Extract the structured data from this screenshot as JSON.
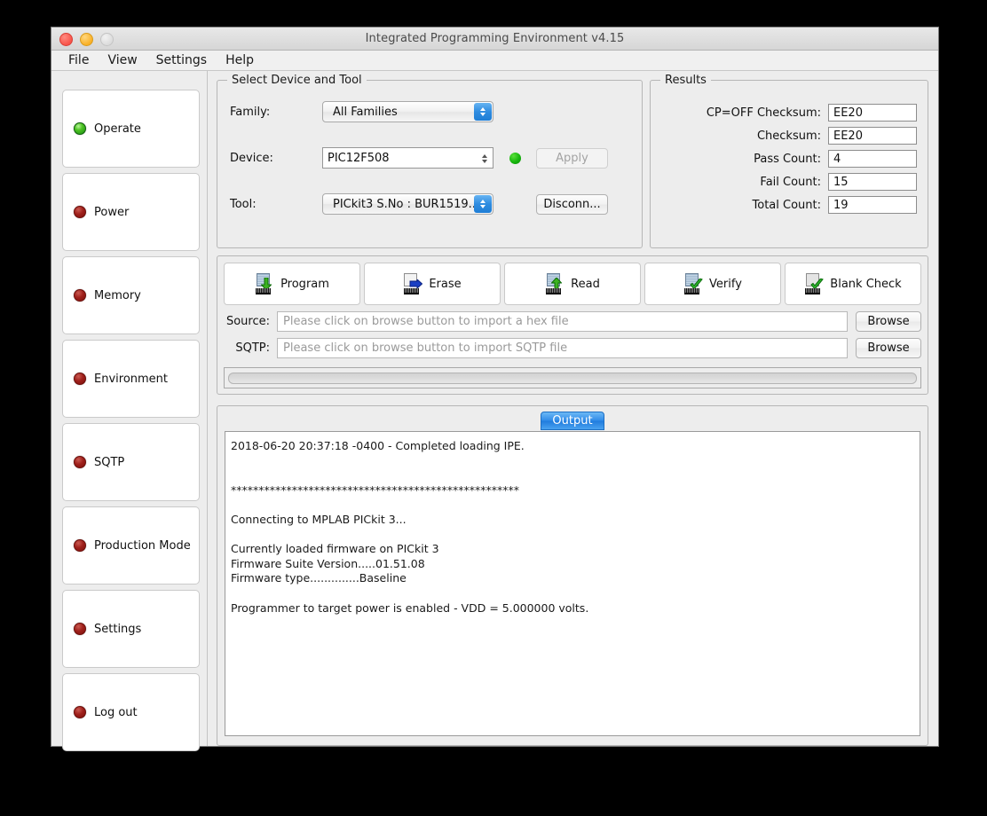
{
  "window": {
    "title": "Integrated Programming Environment v4.15",
    "traffic_lights": [
      "close-button",
      "minimize-button",
      "zoom-button"
    ]
  },
  "menubar": {
    "items": [
      "File",
      "View",
      "Settings",
      "Help"
    ]
  },
  "sidebar": {
    "items": [
      {
        "label": "Operate",
        "led": "green"
      },
      {
        "label": "Power",
        "led": "red"
      },
      {
        "label": "Memory",
        "led": "red"
      },
      {
        "label": "Environment",
        "led": "red"
      },
      {
        "label": "SQTP",
        "led": "red"
      },
      {
        "label": "Production Mode",
        "led": "red"
      },
      {
        "label": "Settings",
        "led": "red"
      },
      {
        "label": "Log out",
        "led": "red"
      }
    ]
  },
  "device_group": {
    "title": "Select Device and Tool",
    "family_label": "Family:",
    "family_value": "All Families",
    "device_label": "Device:",
    "device_value": "PIC12F508",
    "tool_label": "Tool:",
    "tool_value": "PICkit3 S.No : BUR1519...",
    "apply_label": "Apply",
    "disconnect_label": "Disconn...",
    "status_color": "#16b50d"
  },
  "results_group": {
    "title": "Results",
    "rows": [
      {
        "label": "CP=OFF Checksum:",
        "value": "EE20"
      },
      {
        "label": "Checksum:",
        "value": "EE20"
      },
      {
        "label": "Pass Count:",
        "value": "4"
      },
      {
        "label": "Fail Count:",
        "value": "15"
      },
      {
        "label": "Total Count:",
        "value": "19"
      }
    ]
  },
  "actions": [
    {
      "label": "Program",
      "icon": "chip-download-icon"
    },
    {
      "label": "Erase",
      "icon": "chip-erase-icon"
    },
    {
      "label": "Read",
      "icon": "chip-upload-icon"
    },
    {
      "label": "Verify",
      "icon": "chip-check-icon"
    },
    {
      "label": "Blank Check",
      "icon": "blank-check-icon"
    }
  ],
  "paths": {
    "source_label": "Source:",
    "source_placeholder": "Please click on browse button to import a hex file",
    "source_value": "",
    "sqtp_label": "SQTP:",
    "sqtp_placeholder": "Please click on browse button to import SQTP file",
    "sqtp_value": "",
    "browse_label": "Browse"
  },
  "progress": {
    "percent": 0
  },
  "output": {
    "tab_label": "Output",
    "console_text": "2018-06-20 20:37:18 -0400 - Completed loading IPE.\n\n\n****************************************************\n\nConnecting to MPLAB PICkit 3...\n\nCurrently loaded firmware on PICkit 3\nFirmware Suite Version.....01.51.08\nFirmware type..............Baseline\n\nProgrammer to target power is enabled - VDD = 5.000000 volts."
  }
}
